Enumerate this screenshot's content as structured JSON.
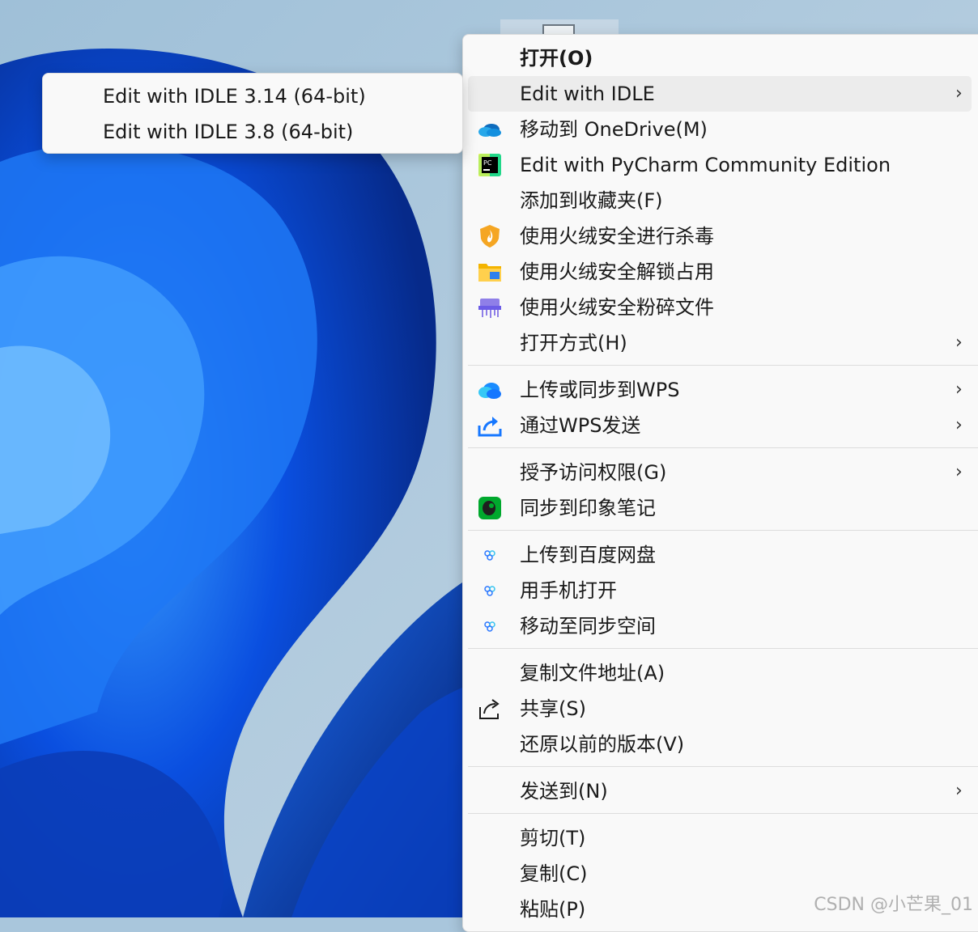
{
  "submenu": {
    "items": [
      {
        "label": "Edit with IDLE 3.14 (64-bit)"
      },
      {
        "label": "Edit with IDLE 3.8 (64-bit)"
      }
    ]
  },
  "menu": {
    "items": [
      {
        "label": "打开(O)",
        "icon": "none",
        "bold": true
      },
      {
        "label": "Edit with IDLE",
        "icon": "none",
        "submenu": true,
        "highlighted": true
      },
      {
        "label": "移动到 OneDrive(M)",
        "icon": "onedrive-icon"
      },
      {
        "label": "Edit with PyCharm Community Edition",
        "icon": "pycharm-icon",
        "icon_text": "PC"
      },
      {
        "label": "添加到收藏夹(F)",
        "icon": "none"
      },
      {
        "label": "使用火绒安全进行杀毒",
        "icon": "huorong-shield-icon"
      },
      {
        "label": "使用火绒安全解锁占用",
        "icon": "huorong-unlock-folder-icon"
      },
      {
        "label": "使用火绒安全粉碎文件",
        "icon": "huorong-shredder-icon"
      },
      {
        "label": "打开方式(H)",
        "icon": "none",
        "submenu": true
      },
      {
        "label": "上传或同步到WPS",
        "icon": "wps-cloud-icon",
        "submenu": true
      },
      {
        "label": "通过WPS发送",
        "icon": "wps-send-icon",
        "submenu": true
      },
      {
        "label": "授予访问权限(G)",
        "icon": "none",
        "submenu": true
      },
      {
        "label": "同步到印象笔记",
        "icon": "evernote-icon"
      },
      {
        "label": "上传到百度网盘",
        "icon": "baidu-netdisk-icon"
      },
      {
        "label": "用手机打开",
        "icon": "baidu-netdisk-icon"
      },
      {
        "label": "移动至同步空间",
        "icon": "baidu-netdisk-icon"
      },
      {
        "label": "复制文件地址(A)",
        "icon": "none"
      },
      {
        "label": "共享(S)",
        "icon": "share-icon"
      },
      {
        "label": "还原以前的版本(V)",
        "icon": "none"
      },
      {
        "label": "发送到(N)",
        "icon": "none",
        "submenu": true
      },
      {
        "label": "剪切(T)",
        "icon": "none"
      },
      {
        "label": "复制(C)",
        "icon": "none"
      },
      {
        "label": "粘贴(P)",
        "icon": "none"
      }
    ],
    "chevron": "›"
  },
  "watermark": "CSDN @小芒果_01",
  "colors": {
    "wallpaper_light": "#a9c6dc",
    "wallpaper_blue": "#0a3fd0",
    "menu_bg": "#f9f9f9",
    "highlight": "#ececec"
  }
}
